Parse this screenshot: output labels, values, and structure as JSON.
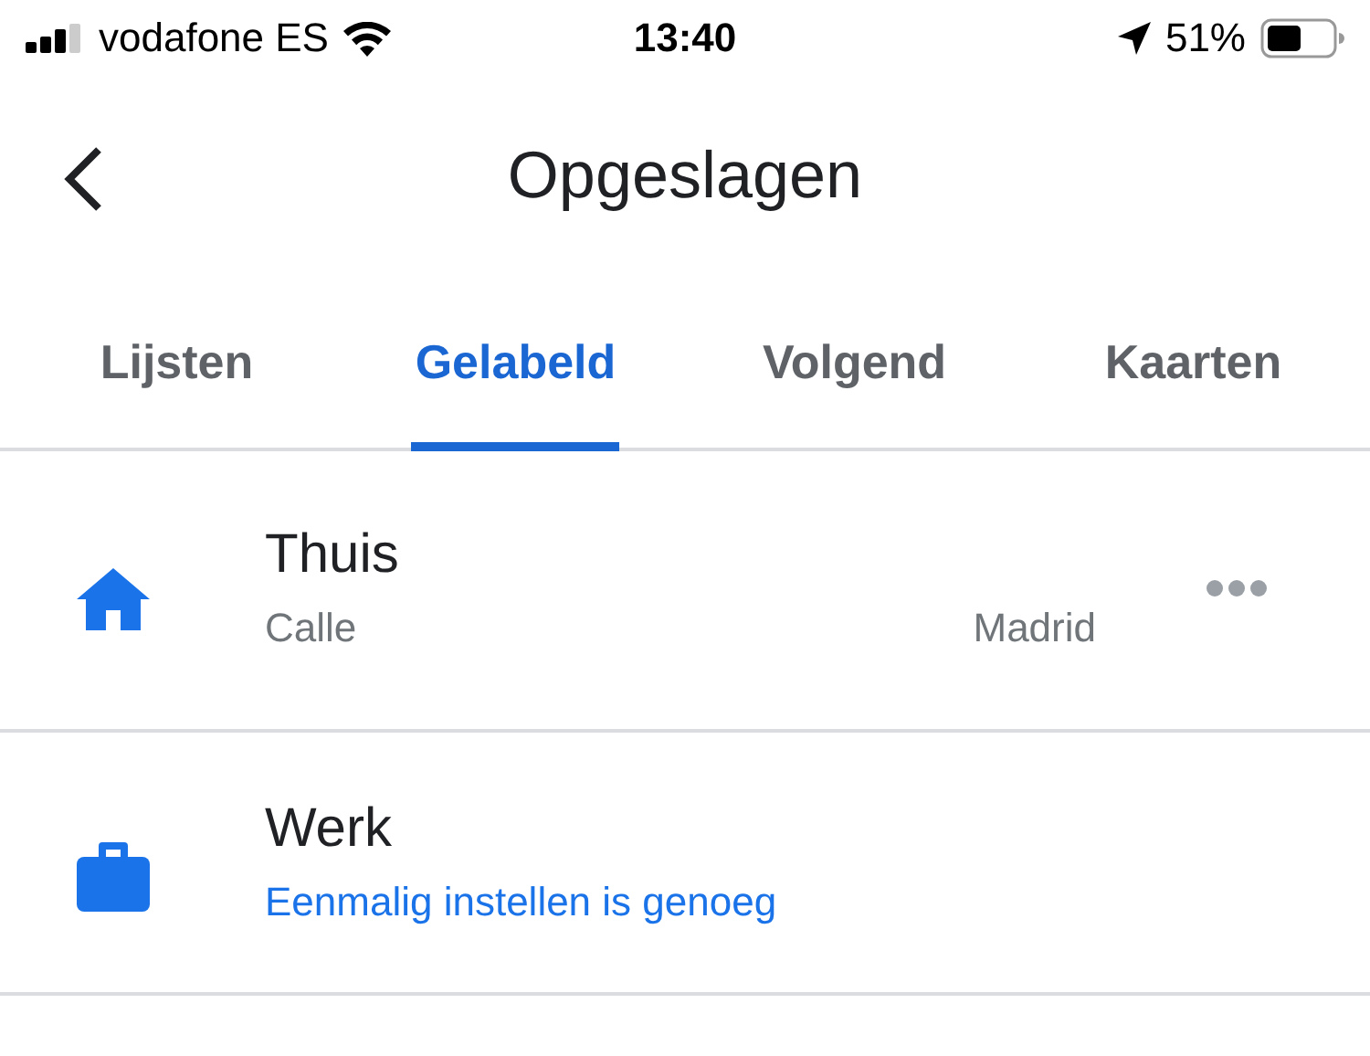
{
  "status_bar": {
    "carrier": "vodafone ES",
    "time": "13:40",
    "battery": "51%"
  },
  "header": {
    "title": "Opgeslagen"
  },
  "tabs": [
    {
      "label": "Lijsten",
      "selected": false
    },
    {
      "label": "Gelabeld",
      "selected": true
    },
    {
      "label": "Volgend",
      "selected": false
    },
    {
      "label": "Kaarten",
      "selected": false
    }
  ],
  "places": [
    {
      "kind": "home",
      "name": "Thuis",
      "address": "Calle",
      "city": "Madrid",
      "more_button": true
    },
    {
      "kind": "work",
      "name": "Werk",
      "hint": "Eenmalig instellen is genoeg"
    }
  ]
}
